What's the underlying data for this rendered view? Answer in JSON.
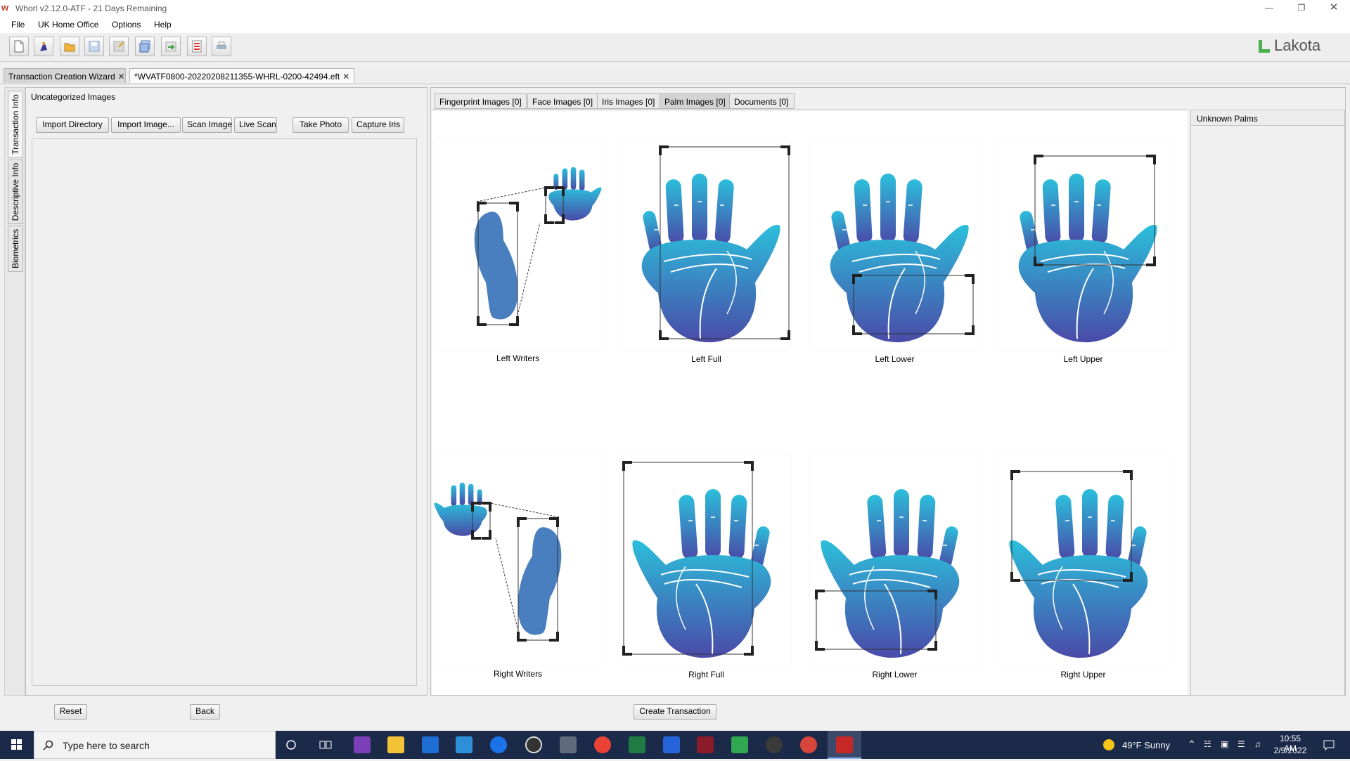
{
  "window": {
    "title": "Whorl v2.12.0-ATF - 21 Days Remaining",
    "icon": "whorl-logo-icon",
    "controls": [
      "minimize",
      "restore",
      "close"
    ]
  },
  "menu": {
    "items": [
      "File",
      "UK Home Office",
      "Options",
      "Help"
    ]
  },
  "toolbar": {
    "buttons": [
      {
        "name": "new-icon"
      },
      {
        "name": "wizard-icon"
      },
      {
        "name": "open-folder-icon"
      },
      {
        "name": "save-icon"
      },
      {
        "name": "save-as-icon"
      },
      {
        "name": "save-all-icon"
      },
      {
        "name": "export-icon"
      },
      {
        "name": "report-icon"
      },
      {
        "name": "print-icon"
      }
    ]
  },
  "brand": {
    "name": "Lakota",
    "color": "#4caf50"
  },
  "doc_tabs": [
    {
      "label": "Transaction Creation Wizard",
      "close": "✕"
    },
    {
      "label": "*WVATF0800-20220208211355-WHRL-0200-42494.eft",
      "close": "✕"
    }
  ],
  "side_tabs": [
    "Transaction Info",
    "Descriptive Info",
    "Biometrics"
  ],
  "left": {
    "title": "Uncategorized Images",
    "buttons": [
      "Import Directory",
      "Import Image...",
      "Scan Image",
      "Live Scan",
      "Take Photo",
      "Capture Iris"
    ]
  },
  "image_tabs": [
    {
      "label": "Fingerprint Images [0]"
    },
    {
      "label": "Face Images [0]"
    },
    {
      "label": "Iris Images [0]"
    },
    {
      "label": "Palm Images [0]",
      "active": true
    },
    {
      "label": "Documents [0]"
    }
  ],
  "palms": [
    {
      "label": "Left Writers",
      "hand": "left",
      "region": "writers"
    },
    {
      "label": "Left Full",
      "hand": "left",
      "region": "full"
    },
    {
      "label": "Left Lower",
      "hand": "left",
      "region": "lower"
    },
    {
      "label": "Left Upper",
      "hand": "left",
      "region": "upper"
    },
    {
      "label": "Right Writers",
      "hand": "right",
      "region": "writers"
    },
    {
      "label": "Right Full",
      "hand": "right",
      "region": "full"
    },
    {
      "label": "Right Lower",
      "hand": "right",
      "region": "lower"
    },
    {
      "label": "Right Upper",
      "hand": "right",
      "region": "upper"
    }
  ],
  "unknown_palms": {
    "title": "Unknown Palms"
  },
  "footer": {
    "reset": "Reset",
    "back": "Back",
    "create": "Create Transaction"
  },
  "taskbar": {
    "search_placeholder": "Type here to search",
    "weather": "49°F  Sunny",
    "time": "10:55 AM",
    "date": "2/9/2022"
  },
  "colors": {
    "palm_top": "#2bbfdb",
    "palm_bottom": "#4a4aa8",
    "writer_blob": "#4a7fbf"
  }
}
